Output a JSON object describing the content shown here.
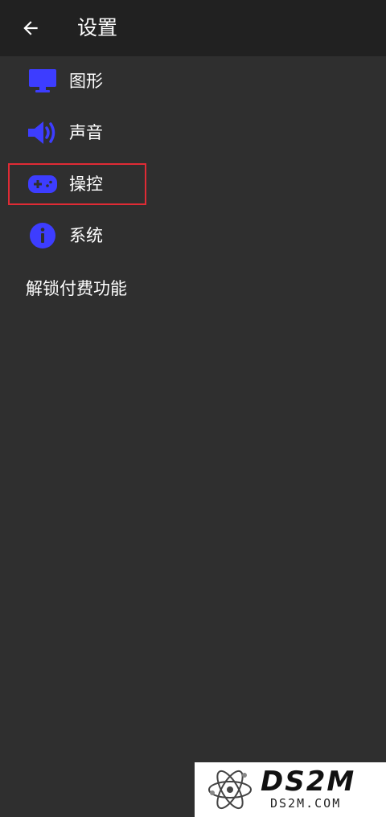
{
  "header": {
    "title": "设置"
  },
  "menu": {
    "items": [
      {
        "label": "图形",
        "icon": "monitor-icon"
      },
      {
        "label": "声音",
        "icon": "speaker-icon"
      },
      {
        "label": "操控",
        "icon": "gamepad-icon"
      },
      {
        "label": "系统",
        "icon": "info-icon"
      }
    ],
    "unlock": "解锁付费功能"
  },
  "watermark": {
    "brand": "DS2M",
    "url": "DS2M.COM"
  },
  "colors": {
    "accent": "#3d3dff",
    "background": "#2f2f2f",
    "topbar": "#212121",
    "highlight": "#e02b35"
  }
}
